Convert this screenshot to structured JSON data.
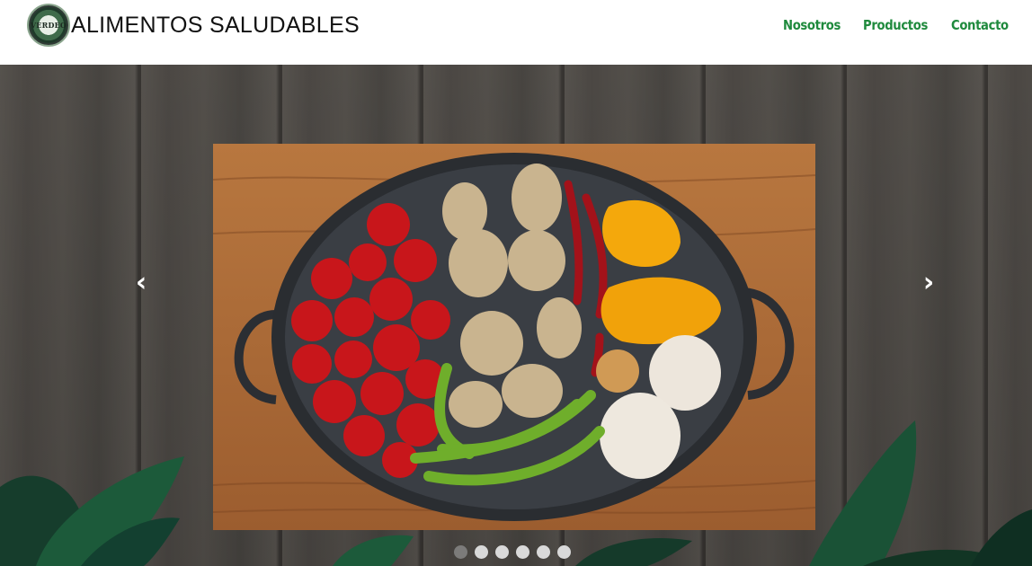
{
  "header": {
    "logo_text": "VERDEO",
    "title": "ALIMENTOS SALUDABLES",
    "nav": [
      {
        "label": "Nosotros"
      },
      {
        "label": "Productos"
      },
      {
        "label": "Contacto"
      }
    ]
  },
  "carousel": {
    "prev_glyph": "‹",
    "next_glyph": "›",
    "slide_count": 6,
    "active_index": 0,
    "slide_alt": "vegetables-in-pan"
  },
  "colors": {
    "nav_green": "#1f8a3d",
    "leaf_green": "#1c5a3a"
  }
}
